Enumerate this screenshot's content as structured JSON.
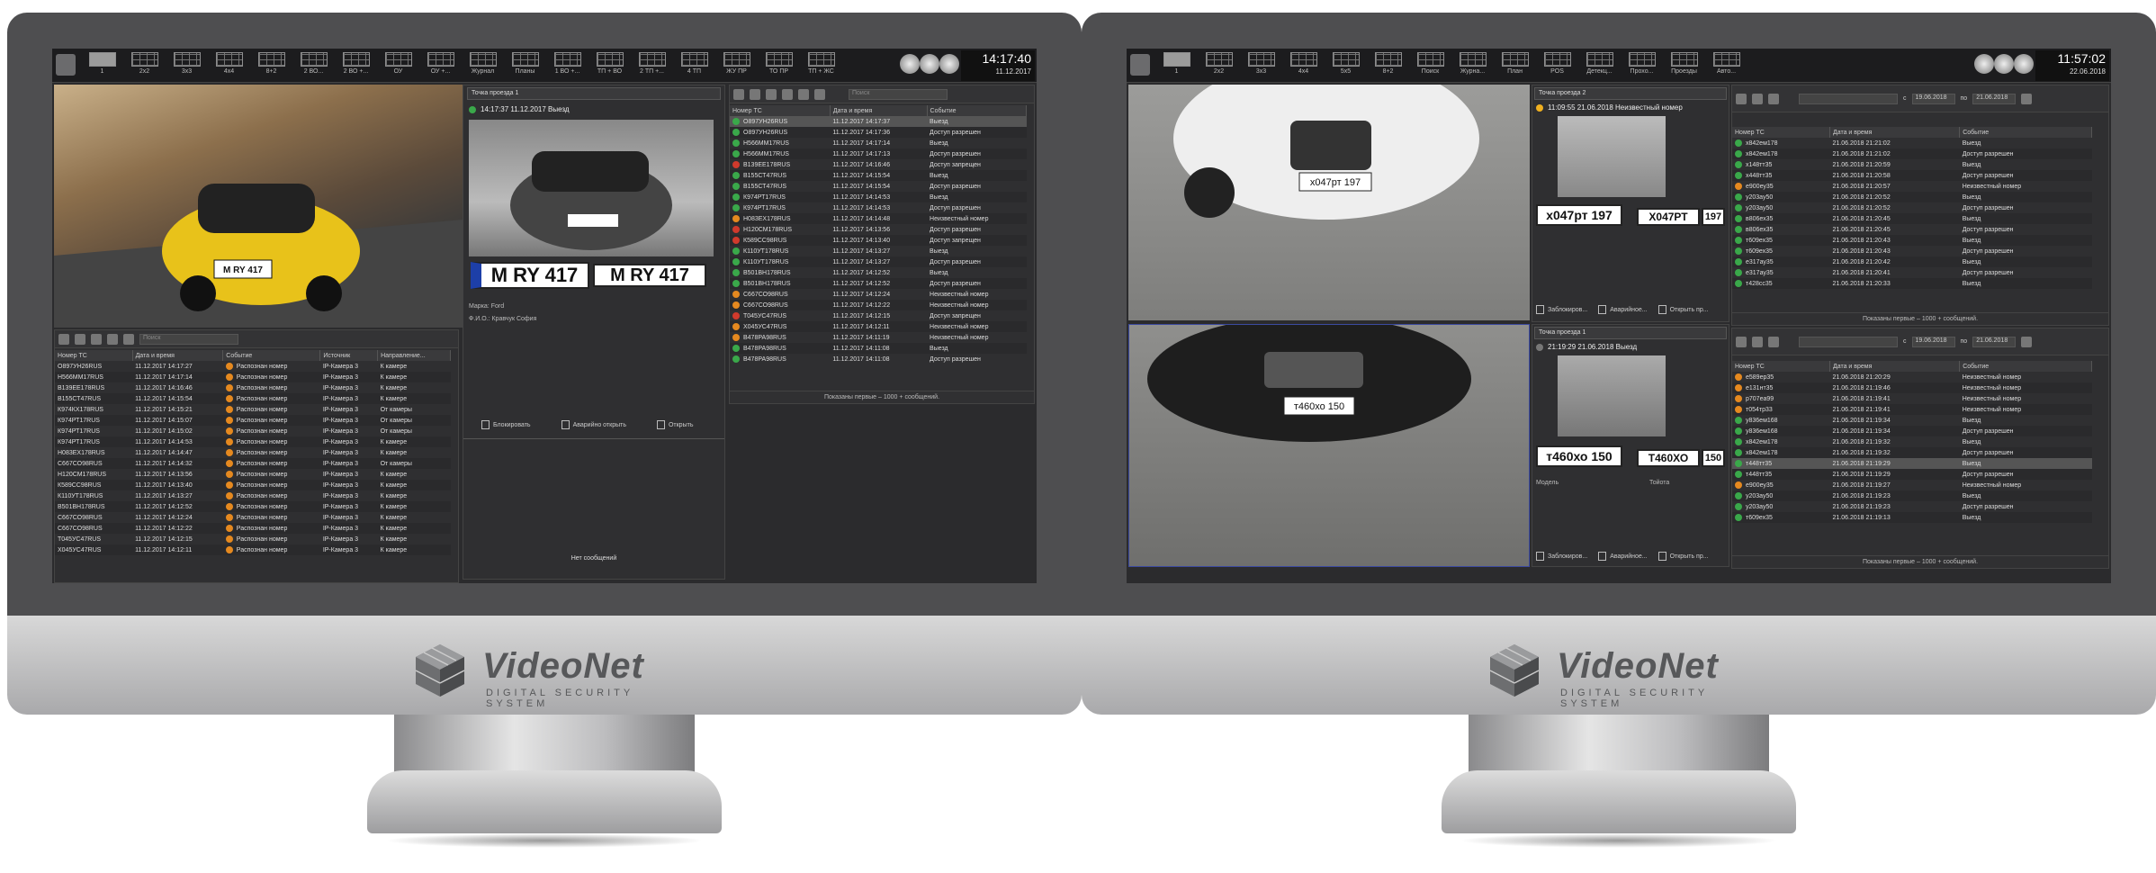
{
  "brand": {
    "name": "VideoNet",
    "tagline": "DIGITAL SECURITY SYSTEM"
  },
  "left": {
    "layouts": [
      "1",
      "2x2",
      "3x3",
      "4x4",
      "8+2",
      "2 ВО...",
      "2 ВО +...",
      "ОУ",
      "ОУ +...",
      "Журнал",
      "Планы",
      "1 ВО +...",
      "ТП + ВО",
      "2 ТП +...",
      "4 ТП",
      "ЖУ ПР",
      "ТО ПР",
      "ТП + ЖС"
    ],
    "clock": {
      "time": "14:17:40",
      "date": "11.12.2017"
    },
    "search_placeholder": "Поиск",
    "event_table": {
      "headers": [
        "Номер ТС",
        "Дата и время",
        "Событие",
        "Источник",
        "Направление..."
      ],
      "rows": [
        [
          "О897УН26RUS",
          "11.12.2017 14:17:27",
          "Распознан номер",
          "IP-Камера 3",
          "К камере"
        ],
        [
          "Н566ММ17RUS",
          "11.12.2017 14:17:14",
          "Распознан номер",
          "IP-Камера 3",
          "К камере"
        ],
        [
          "В139ЕЕ178RUS",
          "11.12.2017 14:16:46",
          "Распознан номер",
          "IP-Камера 3",
          "К камере"
        ],
        [
          "В155СТ47RUS",
          "11.12.2017 14:15:54",
          "Распознан номер",
          "IP-Камера 3",
          "К камере"
        ],
        [
          "К974КХ178RUS",
          "11.12.2017 14:15:21",
          "Распознан номер",
          "IP-Камера 3",
          "От камеры"
        ],
        [
          "К974РТ17RUS",
          "11.12.2017 14:15:07",
          "Распознан номер",
          "IP-Камера 3",
          "От камеры"
        ],
        [
          "К974РТ17RUS",
          "11.12.2017 14:15:02",
          "Распознан номер",
          "IP-Камера 3",
          "От камеры"
        ],
        [
          "К974РТ17RUS",
          "11.12.2017 14:14:53",
          "Распознан номер",
          "IP-Камера 3",
          "К камере"
        ],
        [
          "Н083ЕХ178RUS",
          "11.12.2017 14:14:47",
          "Распознан номер",
          "IP-Камера 3",
          "К камере"
        ],
        [
          "С667СО98RUS",
          "11.12.2017 14:14:32",
          "Распознан номер",
          "IP-Камера 3",
          "От камеры"
        ],
        [
          "Н120СМ178RUS",
          "11.12.2017 14:13:56",
          "Распознан номер",
          "IP-Камера 3",
          "К камере"
        ],
        [
          "К589СС98RUS",
          "11.12.2017 14:13:40",
          "Распознан номер",
          "IP-Камера 3",
          "К камере"
        ],
        [
          "К110УТ178RUS",
          "11.12.2017 14:13:27",
          "Распознан номер",
          "IP-Камера 3",
          "К камере"
        ],
        [
          "В501ВН178RUS",
          "11.12.2017 14:12:52",
          "Распознан номер",
          "IP-Камера 3",
          "К камере"
        ],
        [
          "С667СО98RUS",
          "11.12.2017 14:12:24",
          "Распознан номер",
          "IP-Камера 3",
          "К камере"
        ],
        [
          "С667СО98RUS",
          "11.12.2017 14:12:22",
          "Распознан номер",
          "IP-Камера 3",
          "К камере"
        ],
        [
          "Т045УС47RUS",
          "11.12.2017 14:12:15",
          "Распознан номер",
          "IP-Камера 3",
          "К камере"
        ],
        [
          "Х045УС47RUS",
          "11.12.2017 14:12:11",
          "Распознан номер",
          "IP-Камера 3",
          "К камере"
        ]
      ]
    },
    "checkpoint": {
      "title": "Точка проезда 1",
      "event": "14:17:37 11.12.2017 Выезд",
      "plate_photo": "M RY 417",
      "plate_read": "M RY 417",
      "brand_label": "Марка:",
      "brand_value": "Ford",
      "owner_label": "Ф.И.О.:",
      "owner_value": "Кравчук София",
      "actions": [
        "Блокировать",
        "Аварийно открыть",
        "Открыть"
      ],
      "no_messages": "Нет сообщений"
    },
    "access_table": {
      "headers": [
        "Номер ТС",
        "Дата и время",
        "Событие"
      ],
      "rows": [
        [
          "О897УН26RUS",
          "11.12.2017 14:17:37",
          "Выезд",
          "green"
        ],
        [
          "О897УН26RUS",
          "11.12.2017 14:17:36",
          "Доступ разрешен",
          "green"
        ],
        [
          "Н566ММ17RUS",
          "11.12.2017 14:17:14",
          "Выезд",
          "green"
        ],
        [
          "Н566ММ17RUS",
          "11.12.2017 14:17:13",
          "Доступ разрешен",
          "green"
        ],
        [
          "В139ЕЕ178RUS",
          "11.12.2017 14:16:46",
          "Доступ запрещен",
          "red"
        ],
        [
          "В155СТ47RUS",
          "11.12.2017 14:15:54",
          "Выезд",
          "green"
        ],
        [
          "В155СТ47RUS",
          "11.12.2017 14:15:54",
          "Доступ разрешен",
          "green"
        ],
        [
          "К974РТ17RUS",
          "11.12.2017 14:14:53",
          "Выезд",
          "green"
        ],
        [
          "К974РТ17RUS",
          "11.12.2017 14:14:53",
          "Доступ разрешен",
          "green"
        ],
        [
          "Н083ЕХ178RUS",
          "11.12.2017 14:14:48",
          "Неизвестный номер",
          "orange"
        ],
        [
          "Н120СМ178RUS",
          "11.12.2017 14:13:56",
          "Доступ разрешен",
          "red"
        ],
        [
          "К589СС98RUS",
          "11.12.2017 14:13:40",
          "Доступ запрещен",
          "red"
        ],
        [
          "К110УТ178RUS",
          "11.12.2017 14:13:27",
          "Выезд",
          "green"
        ],
        [
          "К110УТ178RUS",
          "11.12.2017 14:13:27",
          "Доступ разрешен",
          "green"
        ],
        [
          "В501ВН178RUS",
          "11.12.2017 14:12:52",
          "Выезд",
          "green"
        ],
        [
          "В501ВН178RUS",
          "11.12.2017 14:12:52",
          "Доступ разрешен",
          "green"
        ],
        [
          "С667СО98RUS",
          "11.12.2017 14:12:24",
          "Неизвестный номер",
          "orange"
        ],
        [
          "С667СО98RUS",
          "11.12.2017 14:12:22",
          "Неизвестный номер",
          "orange"
        ],
        [
          "Т045УС47RUS",
          "11.12.2017 14:12:15",
          "Доступ запрещен",
          "red"
        ],
        [
          "Х045УС47RUS",
          "11.12.2017 14:12:11",
          "Неизвестный номер",
          "orange"
        ],
        [
          "В478РА98RUS",
          "11.12.2017 14:11:19",
          "Неизвестный номер",
          "orange"
        ],
        [
          "В478РА98RUS",
          "11.12.2017 14:11:08",
          "Выезд",
          "green"
        ],
        [
          "В478РА98RUS",
          "11.12.2017 14:11:08",
          "Доступ разрешен",
          "green"
        ]
      ],
      "footer": {
        "prefix": "Показаны первые",
        "count": "1000",
        "suffix": "сообщений."
      }
    }
  },
  "right": {
    "layouts": [
      "1",
      "2x2",
      "3x3",
      "4x4",
      "5x5",
      "8+2",
      "Поиск",
      "Журна...",
      "План",
      "POS",
      "Детекц...",
      "Прохо...",
      "Проезды",
      "Авто..."
    ],
    "clock": {
      "time": "11:57:02",
      "date": "22.06.2018"
    },
    "cam_top": {
      "plate_photo": "х047рт 197",
      "title": "Точка проезда 2",
      "event": "11:09:55 21.06.2018 Неизвестный номер",
      "plate_read": "Х047РТ",
      "region": "197",
      "actions": [
        "Заблокиров...",
        "Аварийное...",
        "Открыть пр..."
      ]
    },
    "cam_bottom": {
      "plate_photo": "т460хо 150",
      "title": "Точка проезда 1",
      "event": "21:19:29 21.06.2018 Выезд",
      "plate_read": "Т460ХО",
      "region": "150",
      "model_label": "Модель",
      "model_value": "Тойота",
      "actions": [
        "Заблокиров...",
        "Аварийное...",
        "Открыть пр..."
      ]
    },
    "date_from": "19.06.2018",
    "date_to": "21.06.2018",
    "from_label": "с",
    "to_label": "по",
    "table_headers": [
      "Номер ТС",
      "Дата и время",
      "Событие"
    ],
    "table_top": [
      [
        "х842ем178",
        "21.06.2018 21:21:02",
        "Выезд",
        "green"
      ],
      [
        "х842ем178",
        "21.06.2018 21:21:02",
        "Доступ разрешен",
        "green"
      ],
      [
        "х148тт35",
        "21.06.2018 21:20:59",
        "Выезд",
        "green"
      ],
      [
        "х448тт35",
        "21.06.2018 21:20:58",
        "Доступ разрешен",
        "green"
      ],
      [
        "е900еу35",
        "21.06.2018 21:20:57",
        "Неизвестный номер",
        "orange"
      ],
      [
        "у203ау50",
        "21.06.2018 21:20:52",
        "Выезд",
        "green"
      ],
      [
        "у203ау50",
        "21.06.2018 21:20:52",
        "Доступ разрешен",
        "green"
      ],
      [
        "в806ех35",
        "21.06.2018 21:20:45",
        "Выезд",
        "green"
      ],
      [
        "в806ех35",
        "21.06.2018 21:20:45",
        "Доступ разрешен",
        "green"
      ],
      [
        "т609ех35",
        "21.06.2018 21:20:43",
        "Выезд",
        "green"
      ],
      [
        "т609ех35",
        "21.06.2018 21:20:43",
        "Доступ разрешен",
        "green"
      ],
      [
        "е317ау35",
        "21.06.2018 21:20:42",
        "Выезд",
        "green"
      ],
      [
        "е317ау35",
        "21.06.2018 21:20:41",
        "Доступ разрешен",
        "green"
      ],
      [
        "т428сс35",
        "21.06.2018 21:20:33",
        "Выезд",
        "green"
      ]
    ],
    "table_bottom": [
      [
        "е589ер35",
        "21.06.2018 21:20:29",
        "Неизвестный номер",
        "orange"
      ],
      [
        "е131нт35",
        "21.06.2018 21:19:46",
        "Неизвестный номер",
        "orange"
      ],
      [
        "р707еа99",
        "21.06.2018 21:19:41",
        "Неизвестный номер",
        "orange"
      ],
      [
        "т054тр33",
        "21.06.2018 21:19:41",
        "Неизвестный номер",
        "orange"
      ],
      [
        "у836ем168",
        "21.06.2018 21:19:34",
        "Выезд",
        "green"
      ],
      [
        "у836ем168",
        "21.06.2018 21:19:34",
        "Доступ разрешен",
        "green"
      ],
      [
        "х842ем178",
        "21.06.2018 21:19:32",
        "Выезд",
        "green"
      ],
      [
        "х842ем178",
        "21.06.2018 21:19:32",
        "Доступ разрешен",
        "green"
      ],
      [
        "т448тт35",
        "21.06.2018 21:19:29",
        "Выезд",
        "green"
      ],
      [
        "т448тт35",
        "21.06.2018 21:19:29",
        "Доступ разрешен",
        "green"
      ],
      [
        "е900еу35",
        "21.06.2018 21:19:27",
        "Неизвестный номер",
        "orange"
      ],
      [
        "у203ау50",
        "21.06.2018 21:19:23",
        "Выезд",
        "green"
      ],
      [
        "у203ау50",
        "21.06.2018 21:19:23",
        "Доступ разрешен",
        "green"
      ],
      [
        "т609ех35",
        "21.06.2018 21:19:13",
        "Выезд",
        "green"
      ]
    ],
    "footer": {
      "prefix": "Показаны первые",
      "count": "1000",
      "suffix": "сообщений."
    }
  }
}
